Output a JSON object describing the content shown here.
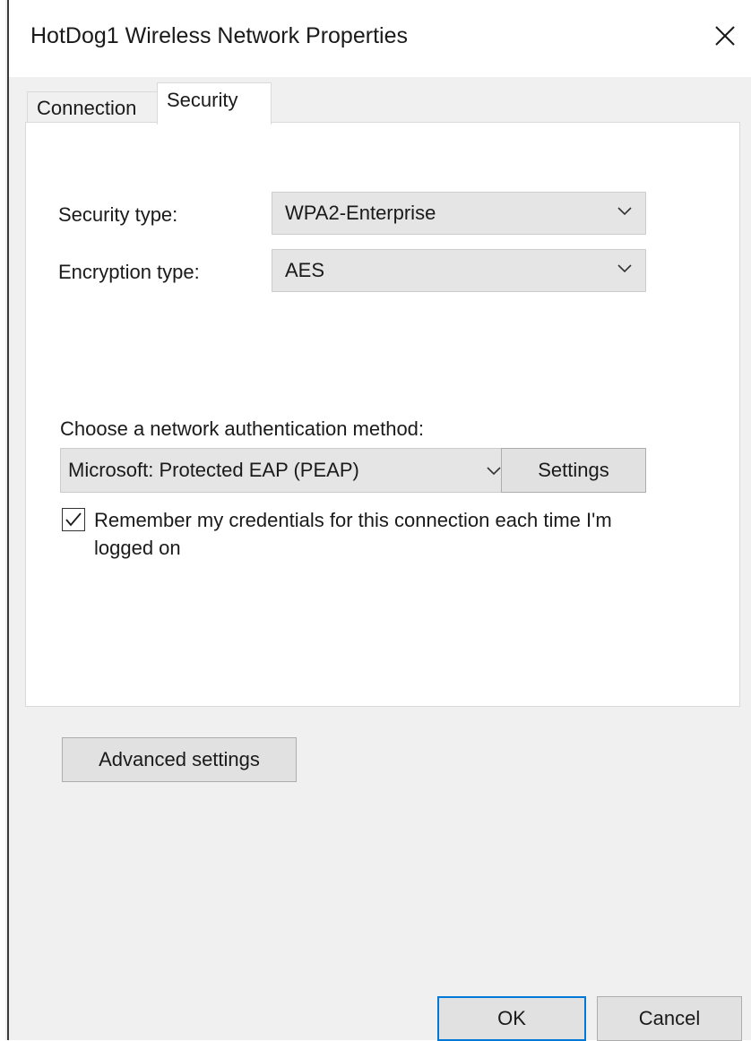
{
  "window": {
    "title": "HotDog1 Wireless Network Properties"
  },
  "tabs": [
    {
      "label": "Connection",
      "active": false
    },
    {
      "label": "Security",
      "active": true
    }
  ],
  "security": {
    "security_type_label": "Security type:",
    "security_type_value": "WPA2-Enterprise",
    "encryption_type_label": "Encryption type:",
    "encryption_type_value": "AES",
    "auth_method_label": "Choose a network authentication method:",
    "auth_method_value": "Microsoft: Protected EAP (PEAP)",
    "settings_button": "Settings",
    "remember_credentials_label": "Remember my credentials for this connection each time I'm logged on",
    "remember_credentials_checked": true,
    "advanced_settings_button": "Advanced settings"
  },
  "footer": {
    "ok_button": "OK",
    "cancel_button": "Cancel"
  },
  "colors": {
    "accent": "#0078d7",
    "dialog_bg": "#f0f0f0",
    "panel_bg": "#ffffff",
    "button_bg": "#e1e1e1",
    "combo_bg": "#e5e5e5"
  },
  "icons": {
    "close": "close-icon",
    "dropdown": "chevron-down-icon",
    "check": "checkmark-icon"
  }
}
